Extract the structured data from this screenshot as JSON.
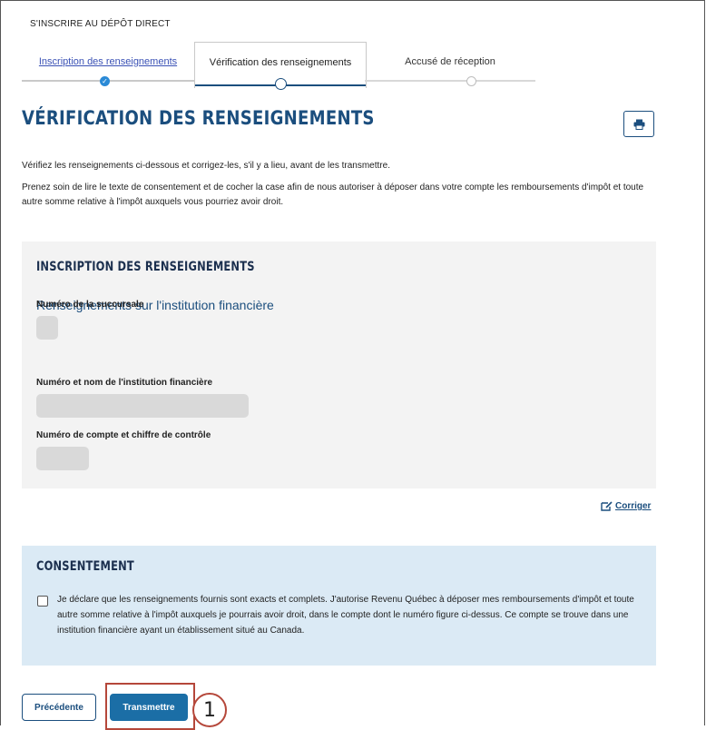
{
  "header": {
    "title": "S'INSCRIRE AU DÉPÔT DIRECT"
  },
  "steps": [
    {
      "label": "Inscription des renseignements",
      "state": "completed"
    },
    {
      "label": "Vérification des renseignements",
      "state": "current"
    },
    {
      "label": "Accusé de réception",
      "state": "pending"
    }
  ],
  "page": {
    "title": "VÉRIFICATION DES RENSEIGNEMENTS",
    "print_icon": "printer-icon",
    "intro": "Vérifiez les renseignements ci-dessous et corrigez-les, s'il y a lieu, avant de les transmettre.",
    "instructions": "Prenez soin de lire le texte de consentement et de cocher la case afin de nous autoriser à déposer dans votre compte les remboursements d'impôt et toute autre somme relative à l'impôt auxquels vous pourriez avoir droit."
  },
  "inscription": {
    "heading": "INSCRIPTION DES RENSEIGNEMENTS",
    "subheading": "Renseignements sur l'institution financière",
    "fields": [
      {
        "label": "Numéro de la succursale"
      },
      {
        "label": "Numéro et nom de l'institution financière"
      },
      {
        "label": "Numéro de compte et chiffre de contrôle"
      }
    ],
    "edit_label": "Corriger"
  },
  "consent": {
    "heading": "CONSENTEMENT",
    "checked": false,
    "text": "Je déclare que les renseignements fournis sont exacts et complets. J'autorise Revenu Québec à déposer mes remboursements d'impôt et toute autre somme relative à l'impôt auxquels je pourrais avoir droit, dans le compte dont le numéro figure ci-dessus. Ce compte se trouve dans une institution financière ayant un établissement situé au Canada."
  },
  "actions": {
    "previous_label": "Précédente",
    "submit_label": "Transmettre"
  },
  "annotation": {
    "callout_label": "1"
  },
  "colors": {
    "primary": "#1b4e7e",
    "button": "#1b6ea6",
    "highlight": "#b5473a",
    "consent_bg": "#dbeaf5",
    "panel_bg": "#f3f3f3"
  }
}
